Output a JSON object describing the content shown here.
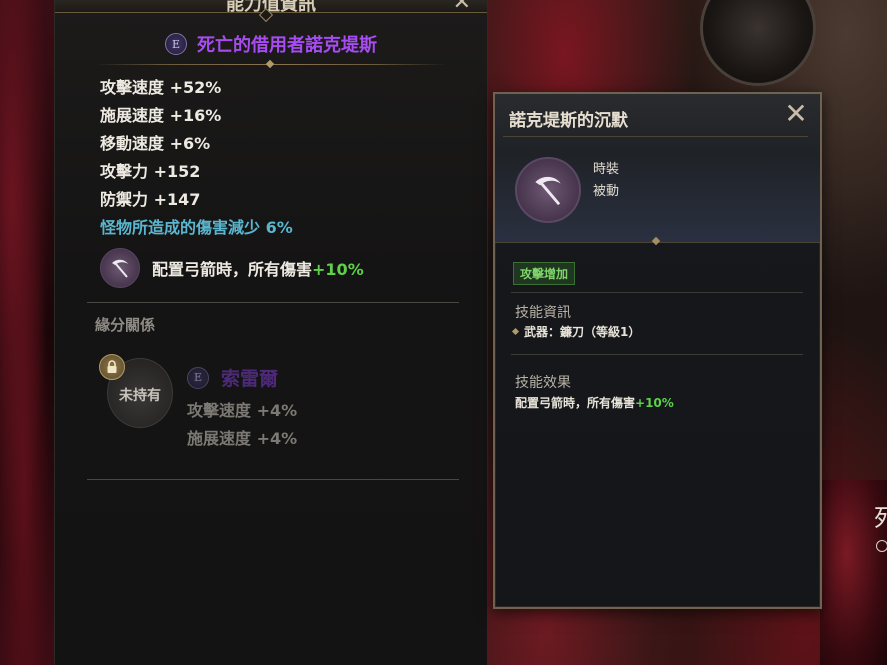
{
  "main_panel": {
    "title": "能力值資訊",
    "card": {
      "grade": "E",
      "name": "死亡的借用者諾克堤斯"
    },
    "stats": [
      "攻擊速度 +52%",
      "施展速度 +16%",
      "移動速度 +6%",
      "攻擊力 +152",
      "防禦力 +147"
    ],
    "special_stat": "怪物所造成的傷害減少 6%",
    "skill_effect": {
      "icon": "scythe-icon",
      "text": "配置弓箭時，所有傷害",
      "bonus": "+10%"
    },
    "bond": {
      "heading": "緣分關係",
      "avatar_status": "未持有",
      "grade": "E",
      "name": "索雷爾",
      "stats": [
        "攻擊速度 +4%",
        "施展速度 +4%"
      ]
    }
  },
  "popup": {
    "title": "諾克堤斯的沉默",
    "skill_icon": "scythe-icon",
    "type_line1": "時裝",
    "type_line2": "被動",
    "tag": "攻擊增加",
    "skill_info_heading": "技能資訊",
    "skill_info_line": "武器：鐮刀（等級1）",
    "skill_effect_heading": "技能效果",
    "skill_effect_text": "配置弓箭時，所有傷害",
    "skill_effect_bonus": "+10%"
  },
  "background": {
    "partial_glyph": "死"
  },
  "colors": {
    "legendary_name": "#a64cf0",
    "cyan_stat": "#5ab6cf",
    "bonus_green": "#5ed04a",
    "dim_bond_name": "#4c2a78",
    "gold_trim": "#6e6350"
  }
}
